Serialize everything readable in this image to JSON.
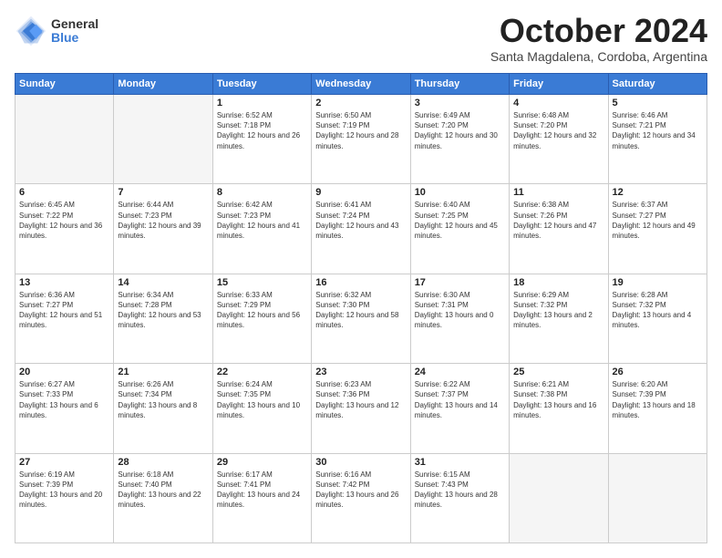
{
  "logo": {
    "general": "General",
    "blue": "Blue"
  },
  "header": {
    "month": "October 2024",
    "location": "Santa Magdalena, Cordoba, Argentina"
  },
  "weekdays": [
    "Sunday",
    "Monday",
    "Tuesday",
    "Wednesday",
    "Thursday",
    "Friday",
    "Saturday"
  ],
  "weeks": [
    [
      {
        "day": "",
        "empty": true
      },
      {
        "day": "",
        "empty": true
      },
      {
        "day": "1",
        "sunrise": "Sunrise: 6:52 AM",
        "sunset": "Sunset: 7:18 PM",
        "daylight": "Daylight: 12 hours and 26 minutes."
      },
      {
        "day": "2",
        "sunrise": "Sunrise: 6:50 AM",
        "sunset": "Sunset: 7:19 PM",
        "daylight": "Daylight: 12 hours and 28 minutes."
      },
      {
        "day": "3",
        "sunrise": "Sunrise: 6:49 AM",
        "sunset": "Sunset: 7:20 PM",
        "daylight": "Daylight: 12 hours and 30 minutes."
      },
      {
        "day": "4",
        "sunrise": "Sunrise: 6:48 AM",
        "sunset": "Sunset: 7:20 PM",
        "daylight": "Daylight: 12 hours and 32 minutes."
      },
      {
        "day": "5",
        "sunrise": "Sunrise: 6:46 AM",
        "sunset": "Sunset: 7:21 PM",
        "daylight": "Daylight: 12 hours and 34 minutes."
      }
    ],
    [
      {
        "day": "6",
        "sunrise": "Sunrise: 6:45 AM",
        "sunset": "Sunset: 7:22 PM",
        "daylight": "Daylight: 12 hours and 36 minutes."
      },
      {
        "day": "7",
        "sunrise": "Sunrise: 6:44 AM",
        "sunset": "Sunset: 7:23 PM",
        "daylight": "Daylight: 12 hours and 39 minutes."
      },
      {
        "day": "8",
        "sunrise": "Sunrise: 6:42 AM",
        "sunset": "Sunset: 7:23 PM",
        "daylight": "Daylight: 12 hours and 41 minutes."
      },
      {
        "day": "9",
        "sunrise": "Sunrise: 6:41 AM",
        "sunset": "Sunset: 7:24 PM",
        "daylight": "Daylight: 12 hours and 43 minutes."
      },
      {
        "day": "10",
        "sunrise": "Sunrise: 6:40 AM",
        "sunset": "Sunset: 7:25 PM",
        "daylight": "Daylight: 12 hours and 45 minutes."
      },
      {
        "day": "11",
        "sunrise": "Sunrise: 6:38 AM",
        "sunset": "Sunset: 7:26 PM",
        "daylight": "Daylight: 12 hours and 47 minutes."
      },
      {
        "day": "12",
        "sunrise": "Sunrise: 6:37 AM",
        "sunset": "Sunset: 7:27 PM",
        "daylight": "Daylight: 12 hours and 49 minutes."
      }
    ],
    [
      {
        "day": "13",
        "sunrise": "Sunrise: 6:36 AM",
        "sunset": "Sunset: 7:27 PM",
        "daylight": "Daylight: 12 hours and 51 minutes."
      },
      {
        "day": "14",
        "sunrise": "Sunrise: 6:34 AM",
        "sunset": "Sunset: 7:28 PM",
        "daylight": "Daylight: 12 hours and 53 minutes."
      },
      {
        "day": "15",
        "sunrise": "Sunrise: 6:33 AM",
        "sunset": "Sunset: 7:29 PM",
        "daylight": "Daylight: 12 hours and 56 minutes."
      },
      {
        "day": "16",
        "sunrise": "Sunrise: 6:32 AM",
        "sunset": "Sunset: 7:30 PM",
        "daylight": "Daylight: 12 hours and 58 minutes."
      },
      {
        "day": "17",
        "sunrise": "Sunrise: 6:30 AM",
        "sunset": "Sunset: 7:31 PM",
        "daylight": "Daylight: 13 hours and 0 minutes."
      },
      {
        "day": "18",
        "sunrise": "Sunrise: 6:29 AM",
        "sunset": "Sunset: 7:32 PM",
        "daylight": "Daylight: 13 hours and 2 minutes."
      },
      {
        "day": "19",
        "sunrise": "Sunrise: 6:28 AM",
        "sunset": "Sunset: 7:32 PM",
        "daylight": "Daylight: 13 hours and 4 minutes."
      }
    ],
    [
      {
        "day": "20",
        "sunrise": "Sunrise: 6:27 AM",
        "sunset": "Sunset: 7:33 PM",
        "daylight": "Daylight: 13 hours and 6 minutes."
      },
      {
        "day": "21",
        "sunrise": "Sunrise: 6:26 AM",
        "sunset": "Sunset: 7:34 PM",
        "daylight": "Daylight: 13 hours and 8 minutes."
      },
      {
        "day": "22",
        "sunrise": "Sunrise: 6:24 AM",
        "sunset": "Sunset: 7:35 PM",
        "daylight": "Daylight: 13 hours and 10 minutes."
      },
      {
        "day": "23",
        "sunrise": "Sunrise: 6:23 AM",
        "sunset": "Sunset: 7:36 PM",
        "daylight": "Daylight: 13 hours and 12 minutes."
      },
      {
        "day": "24",
        "sunrise": "Sunrise: 6:22 AM",
        "sunset": "Sunset: 7:37 PM",
        "daylight": "Daylight: 13 hours and 14 minutes."
      },
      {
        "day": "25",
        "sunrise": "Sunrise: 6:21 AM",
        "sunset": "Sunset: 7:38 PM",
        "daylight": "Daylight: 13 hours and 16 minutes."
      },
      {
        "day": "26",
        "sunrise": "Sunrise: 6:20 AM",
        "sunset": "Sunset: 7:39 PM",
        "daylight": "Daylight: 13 hours and 18 minutes."
      }
    ],
    [
      {
        "day": "27",
        "sunrise": "Sunrise: 6:19 AM",
        "sunset": "Sunset: 7:39 PM",
        "daylight": "Daylight: 13 hours and 20 minutes."
      },
      {
        "day": "28",
        "sunrise": "Sunrise: 6:18 AM",
        "sunset": "Sunset: 7:40 PM",
        "daylight": "Daylight: 13 hours and 22 minutes."
      },
      {
        "day": "29",
        "sunrise": "Sunrise: 6:17 AM",
        "sunset": "Sunset: 7:41 PM",
        "daylight": "Daylight: 13 hours and 24 minutes."
      },
      {
        "day": "30",
        "sunrise": "Sunrise: 6:16 AM",
        "sunset": "Sunset: 7:42 PM",
        "daylight": "Daylight: 13 hours and 26 minutes."
      },
      {
        "day": "31",
        "sunrise": "Sunrise: 6:15 AM",
        "sunset": "Sunset: 7:43 PM",
        "daylight": "Daylight: 13 hours and 28 minutes."
      },
      {
        "day": "",
        "empty": true
      },
      {
        "day": "",
        "empty": true
      }
    ]
  ]
}
